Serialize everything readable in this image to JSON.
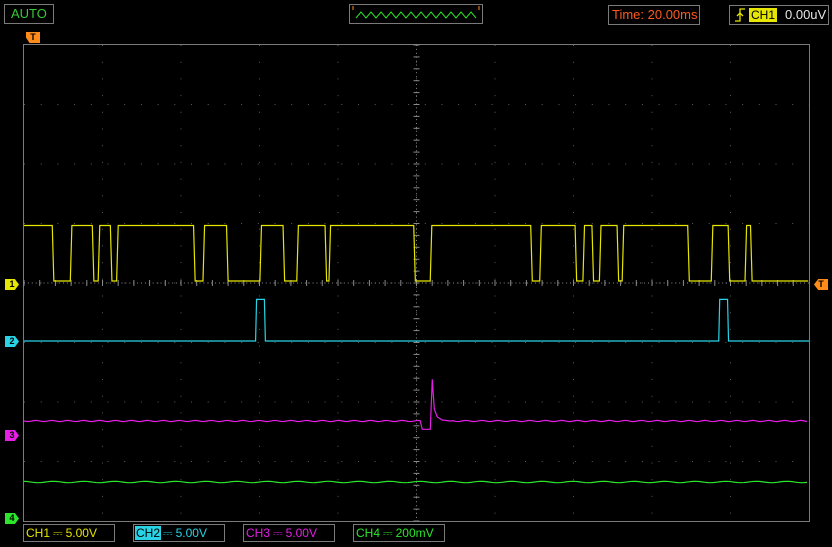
{
  "top_bar": {
    "mode": "AUTO",
    "timebase": "Time: 20.00ms",
    "trigger": {
      "source": "CH1",
      "level": "0.00uV",
      "edge_icon": "rising-edge-icon",
      "color": "#e6e600"
    }
  },
  "markers": {
    "trigger_position": "T",
    "trigger_level": "T",
    "channels": [
      "1",
      "2",
      "3",
      "4"
    ]
  },
  "colors": {
    "ch1": "#e6e600",
    "ch2": "#29d3e6",
    "ch3": "#e61ee6",
    "ch4": "#2ce62c",
    "trigger": "#ff8c1a",
    "timebase_text": "#ff5a1e",
    "mode_text": "#38c838"
  },
  "channels": [
    {
      "name": "CH1",
      "coupling_icon": "dc-coupling-icon",
      "scale": "5.00V",
      "color": "#e6e600",
      "highlight_name": false
    },
    {
      "name": "CH2",
      "coupling_icon": "dc-coupling-icon",
      "scale": "5.00V",
      "color": "#29d3e6",
      "highlight_name": true
    },
    {
      "name": "CH3",
      "coupling_icon": "dc-coupling-icon",
      "scale": "5.00V",
      "color": "#e61ee6",
      "highlight_name": false
    },
    {
      "name": "CH4",
      "coupling_icon": "dc-coupling-icon",
      "scale": "200mV",
      "color": "#2ce62c",
      "highlight_name": false
    }
  ],
  "chart_data": {
    "type": "line",
    "x_unit": "ms",
    "xlim": [
      0,
      200
    ],
    "grid": true,
    "series": [
      {
        "name": "CH1",
        "values_v": [
          5,
          0
        ],
        "edges_ms": [
          0,
          7.4,
          12.0,
          17.6,
          19.1,
          22.2,
          23.8,
          43.4,
          45.8,
          51.8,
          60.3,
          66.2,
          69.7,
          76.9,
          77.9,
          99.5,
          103.7,
          129.3,
          131.6,
          140.6,
          142.6,
          144.9,
          146.8,
          151.3,
          152.6,
          169.3,
          175.3,
          179.6,
          183.9,
          185.3,
          200
        ],
        "start_level": "high"
      },
      {
        "name": "CH2",
        "baseline_v": 0,
        "pulse_height_v": 3.5,
        "pulses_ms": [
          [
            59.0,
            61.5
          ],
          [
            177.0,
            179.5
          ]
        ]
      },
      {
        "name": "CH3",
        "baseline_v": 0,
        "spike_ms": 103.0,
        "spike_peak_v": 3.5,
        "dip_v": -0.7
      },
      {
        "name": "CH4",
        "baseline_v": 0,
        "note_level": "flat"
      }
    ]
  }
}
